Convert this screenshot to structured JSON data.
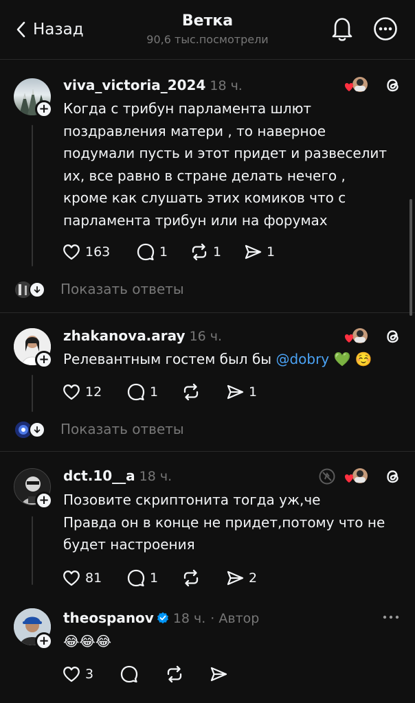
{
  "header": {
    "back_label": "Назад",
    "title": "Ветка",
    "subtitle": "90,6 тыс.посмотрели"
  },
  "posts": [
    {
      "username": "viva_victoria_2024",
      "time": "18 ч.",
      "lines": [
        "Когда с трибун парламента шлют",
        "поздравления матери , то наверное",
        "подумали пусть и этот придет и развеселит",
        "их, все равно в стране делать нечего ,",
        "кроме как слушать этих комиков что с",
        "парламента трибун или на форумах"
      ],
      "likes": "163",
      "replies": "1",
      "reposts": "1",
      "shares": "1",
      "show_replies_label": "Показать ответы"
    },
    {
      "username": "zhakanova.aray",
      "time": "16 ч.",
      "text_before": "Релевантным гостем был бы ",
      "mention": "@dobry",
      "text_after": " 💚 ☺️",
      "likes": "12",
      "replies": "1",
      "reposts": "",
      "shares": "1",
      "show_replies_label": "Показать ответы"
    },
    {
      "username": "dct.10__a",
      "time": "18 ч.",
      "lines": [
        "Позовите скриптонита тогда уж,че",
        "Правда он в конце не придет,потому что не",
        "будет настроения"
      ],
      "likes": "81",
      "replies": "1",
      "reposts": "",
      "shares": "2"
    },
    {
      "username": "theospanov",
      "time": "18 ч.",
      "author_label": "· Автор",
      "text": "😂😂😂",
      "likes": "3"
    }
  ],
  "icons": [
    "chevron-left-icon",
    "bell-icon",
    "more-icon",
    "heart-icon",
    "comment-icon",
    "repost-icon",
    "share-icon",
    "threads-icon",
    "verified-icon",
    "arrow-down-icon"
  ],
  "colors": {
    "background": "#101010",
    "text": "#f3f5f7",
    "muted": "#777777",
    "mention": "#4ba3f5",
    "verified": "#0095f6",
    "heart": "#ff3040"
  }
}
